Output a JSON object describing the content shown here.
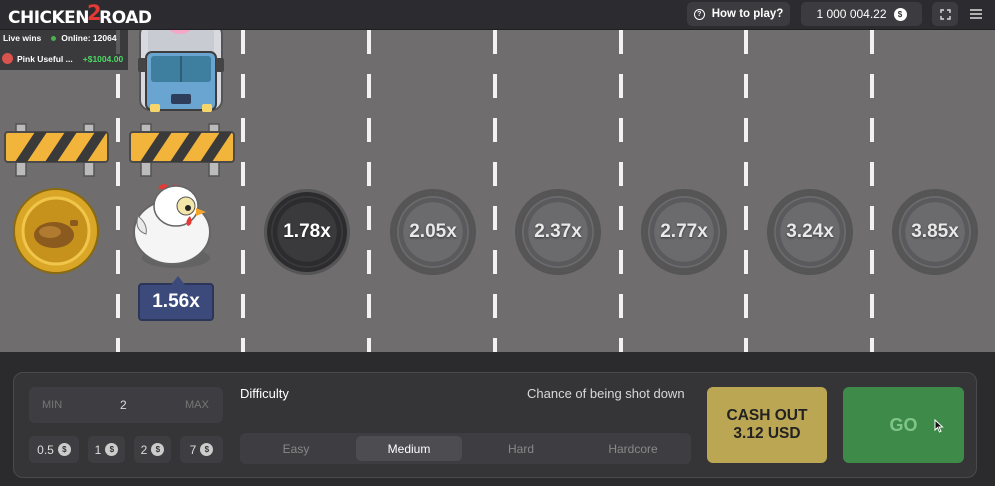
{
  "header": {
    "logo_left": "CHICKEN",
    "logo_mid": "2",
    "logo_right": "ROAD",
    "how_to_play": "How to play?",
    "balance": "1 000 004.22",
    "currency_symbol": "$"
  },
  "live": {
    "label": "Live wins",
    "online": "Online: 12064",
    "player_name": "Pink Useful ...",
    "player_win": "+$1004.00"
  },
  "road": {
    "current_multiplier": "1.56x",
    "multipliers": [
      "1.78x",
      "2.05x",
      "2.37x",
      "2.77x",
      "3.24x",
      "3.85x"
    ]
  },
  "bet": {
    "min_label": "MIN",
    "value": "2",
    "max_label": "MAX",
    "quick_amounts": [
      "0.5",
      "1",
      "2",
      "7"
    ]
  },
  "difficulty": {
    "label": "Difficulty",
    "chance_label": "Chance of being shot down",
    "options": [
      "Easy",
      "Medium",
      "Hard",
      "Hardcore"
    ],
    "selected": "Medium"
  },
  "actions": {
    "cashout_line1": "CASH OUT",
    "cashout_line2": "3.12 USD",
    "go_label": "GO"
  },
  "colors": {
    "road": "#6f6d6e",
    "cashout": "#bba653",
    "go": "#3e8b49",
    "current_chip": "#3b4a7a"
  }
}
